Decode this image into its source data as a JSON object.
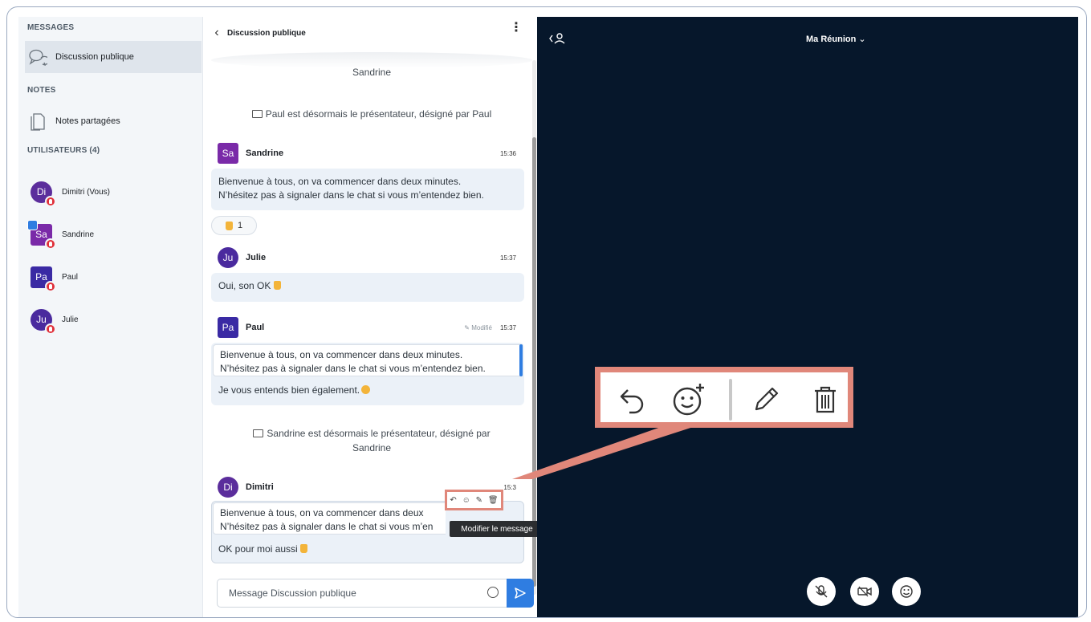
{
  "sidebar": {
    "messages_title": "MESSAGES",
    "public_chat_label": "Discussion publique",
    "notes_title": "NOTES",
    "shared_notes_label": "Notes partagées",
    "users_title": "UTILISATEURS (4)",
    "users": [
      {
        "initials": "Di",
        "name": "Dimitri (Vous)",
        "color": "#5b2d9c",
        "shape": "circle"
      },
      {
        "initials": "Sa",
        "name": "Sandrine",
        "color": "#7a2aa8",
        "shape": "square"
      },
      {
        "initials": "Pa",
        "name": "Paul",
        "color": "#3a2aa4",
        "shape": "square"
      },
      {
        "initials": "Ju",
        "name": "Julie",
        "color": "#4a2a9e",
        "shape": "circle"
      }
    ]
  },
  "chat": {
    "header_title": "Discussion publique",
    "top_system_text": "Sandrine",
    "system_1": "Paul est désormais le présentateur, désigné par Paul",
    "msg_sandrine": {
      "initials": "Sa",
      "name": "Sandrine",
      "time": "15:36",
      "line1": "Bienvenue à tous, on va commencer dans deux minutes.",
      "line2": "N’hésitez pas à signaler dans le chat si vous m’entendez bien.",
      "reaction_count": "1"
    },
    "msg_julie": {
      "initials": "Ju",
      "name": "Julie",
      "time": "15:37",
      "text": "Oui, son OK"
    },
    "msg_paul": {
      "initials": "Pa",
      "name": "Paul",
      "edited": "Modifié",
      "time": "15:37",
      "quote1": "Bienvenue à tous, on va commencer dans deux minutes.",
      "quote2": "N’hésitez pas à signaler dans le chat si vous m’entendez bien.",
      "text": "Je vous entends bien également."
    },
    "system_2_line1": "Sandrine est désormais le présentateur, désigné par",
    "system_2_line2": "Sandrine",
    "msg_dimitri": {
      "initials": "Di",
      "name": "Dimitri",
      "time": "15:3",
      "quote1": "Bienvenue à tous, on va commencer dans deux",
      "quote2": "N’hésitez pas à signaler dans le chat si vous m’en",
      "text": "OK pour moi aussi"
    },
    "tooltip": "Modifier le message",
    "input_placeholder": "Message Discussion publique"
  },
  "stage": {
    "meeting_title": "Ma Réunion"
  },
  "colors": {
    "accent": "#2f7de1",
    "callout": "#e0877a",
    "stage_bg": "#06172b"
  }
}
